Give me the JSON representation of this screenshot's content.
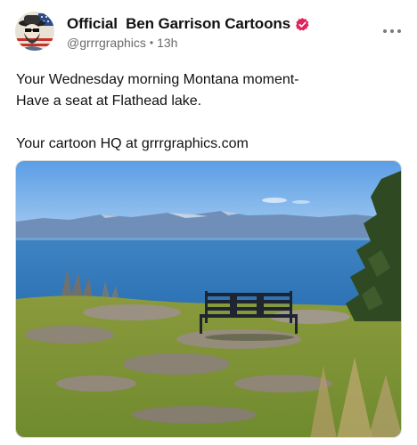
{
  "post": {
    "author": {
      "display_name": "Official  Ben Garrison Cartoons",
      "handle": "@grrrgraphics",
      "time_ago": "13h",
      "verified_badge_color": "#e0245e"
    },
    "text_lines": [
      "Your Wednesday morning Montana moment-",
      "Have a seat at Flathead lake.",
      "",
      "Your cartoon HQ at grrrgraphics.com"
    ],
    "media": {
      "kind": "photo"
    },
    "icons": {
      "avatar": "avatar-icon",
      "verified": "verified-badge-icon",
      "more": "more-options-icon"
    }
  }
}
